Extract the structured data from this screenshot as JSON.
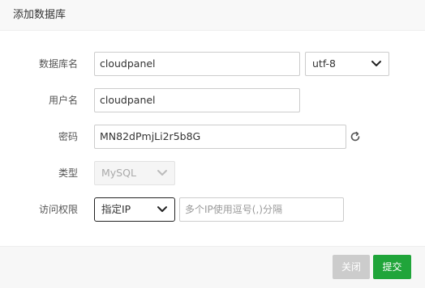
{
  "dialog": {
    "title": "添加数据库"
  },
  "form": {
    "db_name": {
      "label": "数据库名",
      "value": "cloudpanel",
      "charset": "utf-8"
    },
    "username": {
      "label": "用户名",
      "value": "cloudpanel"
    },
    "password": {
      "label": "密码",
      "value": "MN82dPmjLi2r5b8G"
    },
    "type": {
      "label": "类型",
      "value": "MySQL"
    },
    "access": {
      "label": "访问权限",
      "value": "指定IP",
      "ip_placeholder": "多个IP使用逗号(,)分隔"
    }
  },
  "footer": {
    "close_label": "关闭",
    "submit_label": "提交"
  },
  "colors": {
    "primary_green": "#20a53a",
    "close_gray": "#cccccc"
  },
  "icons": {
    "refresh": "refresh-icon",
    "chevron": "chevron-down-icon"
  }
}
